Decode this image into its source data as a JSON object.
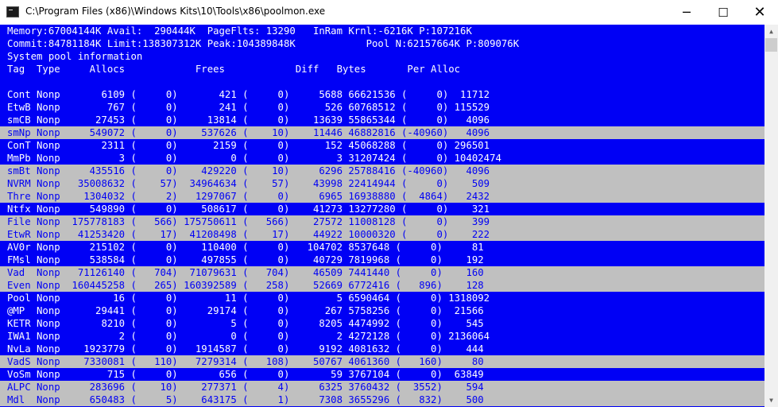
{
  "window": {
    "title": "C:\\Program Files (x86)\\Windows Kits\\10\\Tools\\x86\\poolmon.exe",
    "minimize_glyph": "─",
    "maximize_glyph": "☐",
    "close_glyph": "✕",
    "app_icon": "console-icon"
  },
  "colors": {
    "console_bg": "#0000f5",
    "console_fg": "#ffffff",
    "highlight_bg": "#c0c0c0",
    "highlight_fg": "#0000f5"
  },
  "header": {
    "line1": "Memory:67004144K Avail:  290444K  PageFlts: 13290   InRam Krnl:-6216K P:107216K",
    "line2": "Commit:84781184K Limit:138307312K Peak:104389848K            Pool N:62157664K P:809076K",
    "line3": "System pool information",
    "columns": "Tag  Type     Allocs            Frees            Diff   Bytes       Per Alloc"
  },
  "rows": [
    {
      "text": "Cont Nonp       6109 (     0)       421 (     0)     5688 66621536 (     0)  11712",
      "highlight": false
    },
    {
      "text": "EtwB Nonp        767 (     0)       241 (     0)      526 60768512 (     0) 115529",
      "highlight": false
    },
    {
      "text": "smCB Nonp      27453 (     0)     13814 (     0)    13639 55865344 (     0)   4096",
      "highlight": false
    },
    {
      "text": "smNp Nonp     549072 (     0)    537626 (    10)    11446 46882816 (-40960)   4096",
      "highlight": true
    },
    {
      "text": "ConT Nonp       2311 (     0)      2159 (     0)      152 45068288 (     0) 296501",
      "highlight": false
    },
    {
      "text": "MmPb Nonp          3 (     0)         0 (     0)        3 31207424 (     0) 10402474",
      "highlight": false
    },
    {
      "text": "smBt Nonp     435516 (     0)    429220 (    10)     6296 25788416 (-40960)   4096",
      "highlight": true
    },
    {
      "text": "NVRM Nonp   35008632 (    57)  34964634 (    57)    43998 22414944 (     0)    509",
      "highlight": true
    },
    {
      "text": "Thre Nonp    1304032 (     2)   1297067 (     0)     6965 16938880 (  4864)   2432",
      "highlight": true
    },
    {
      "text": "Ntfx Nonp     549890 (     0)    508617 (     0)    41273 13277280 (     0)    321",
      "highlight": false
    },
    {
      "text": "File Nonp  175778183 (   566) 175750611 (   566)    27572 11008128 (     0)    399",
      "highlight": true
    },
    {
      "text": "EtwR Nonp   41253420 (    17)  41208498 (    17)    44922 10000320 (     0)    222",
      "highlight": true
    },
    {
      "text": "AV0r Nonp     215102 (     0)    110400 (     0)   104702 8537648 (     0)     81",
      "highlight": false
    },
    {
      "text": "FMsl Nonp     538584 (     0)    497855 (     0)    40729 7819968 (     0)    192",
      "highlight": false
    },
    {
      "text": "Vad  Nonp   71126140 (   704)  71079631 (   704)    46509 7441440 (     0)    160",
      "highlight": true
    },
    {
      "text": "Even Nonp  160445258 (   265) 160392589 (   258)    52669 6772416 (   896)    128",
      "highlight": true
    },
    {
      "text": "Pool Nonp         16 (     0)        11 (     0)        5 6590464 (     0) 1318092",
      "highlight": false
    },
    {
      "text": "@MP  Nonp      29441 (     0)     29174 (     0)      267 5758256 (     0)  21566",
      "highlight": false
    },
    {
      "text": "KETR Nonp       8210 (     0)         5 (     0)     8205 4474992 (     0)    545",
      "highlight": false
    },
    {
      "text": "IWA1 Nonp          2 (     0)         0 (     0)        2 4272128 (     0) 2136064",
      "highlight": false
    },
    {
      "text": "NvLa Nonp    1923779 (     0)   1914587 (     0)     9192 4081632 (     0)    444",
      "highlight": false
    },
    {
      "text": "VadS Nonp    7330081 (   110)   7279314 (   108)    50767 4061360 (   160)     80",
      "highlight": true
    },
    {
      "text": "VoSm Nonp        715 (     0)       656 (     0)       59 3767104 (     0)  63849",
      "highlight": false
    },
    {
      "text": "ALPC Nonp     283696 (    10)    277371 (     4)     6325 3760432 (  3552)    594",
      "highlight": true
    },
    {
      "text": "Mdl  Nonp     650483 (     5)    643175 (     1)     7308 3655296 (   832)    500",
      "highlight": true
    }
  ],
  "scrollbar": {
    "up_glyph": "▲",
    "down_glyph": "▼"
  }
}
